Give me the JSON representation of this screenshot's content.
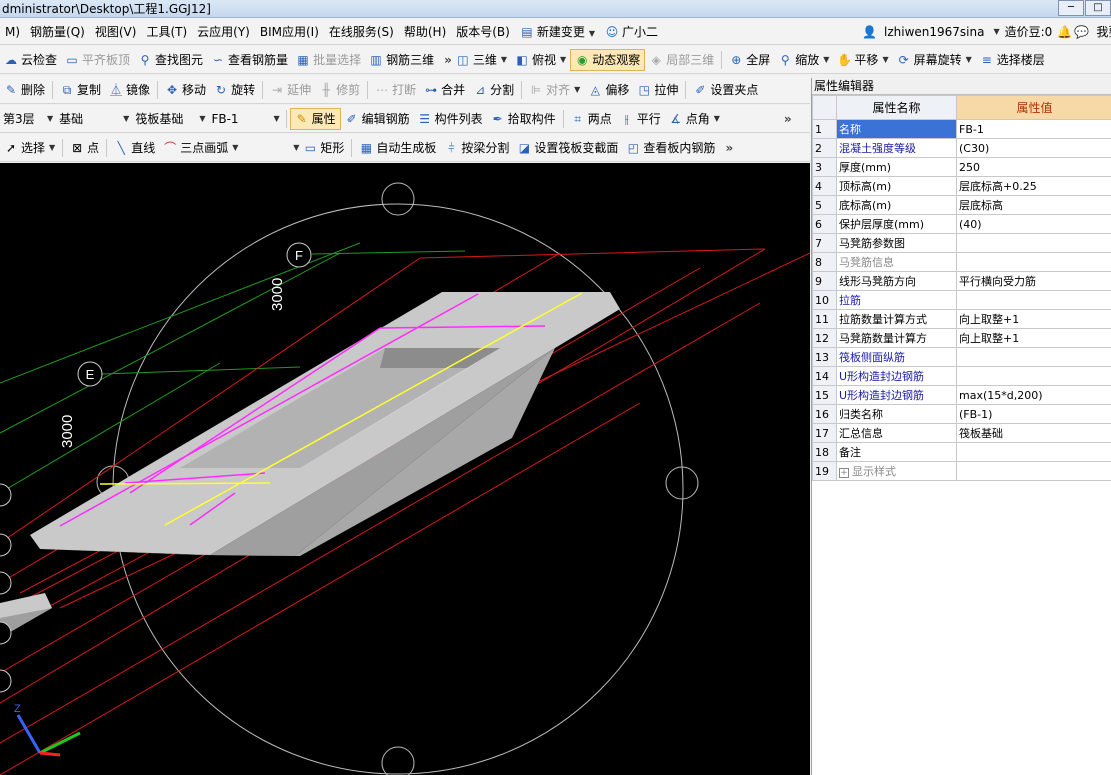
{
  "title": "dministrator\\Desktop\\工程1.GGJ12]",
  "menu": [
    "M)",
    "钢筋量(Q)",
    "视图(V)",
    "工具(T)",
    "云应用(Y)",
    "BIM应用(I)",
    "在线服务(S)",
    "帮助(H)",
    "版本号(B)",
    "新建变更",
    "广小二"
  ],
  "user": {
    "name": "lzhiwen1967sina",
    "price": "造价豆:0",
    "extra": "我要"
  },
  "toolbar1": [
    "云检查",
    "平齐板顶",
    "查找图元",
    "查看钢筋量",
    "批量选择",
    "钢筋三维",
    "三维",
    "俯视",
    "动态观察",
    "局部三维",
    "全屏",
    "缩放",
    "平移",
    "屏幕旋转",
    "选择楼层"
  ],
  "toolbar2": [
    "删除",
    "复制",
    "镜像",
    "移动",
    "旋转",
    "延伸",
    "修剪",
    "打断",
    "合并",
    "分割",
    "对齐",
    "偏移",
    "拉伸",
    "设置夹点"
  ],
  "toolbar3": {
    "floor": "第3层",
    "type": "基础",
    "subtype": "筏板基础",
    "element": "FB-1",
    "buttons": [
      "属性",
      "编辑钢筋",
      "构件列表",
      "拾取构件",
      "两点",
      "平行",
      "点角"
    ]
  },
  "toolbar4": [
    "选择",
    "点",
    "直线",
    "三点画弧",
    "矩形",
    "自动生成板",
    "按梁分割",
    "设置筏板变截面",
    "查看板内钢筋"
  ],
  "canvas": {
    "labels": {
      "axis_f": "F",
      "axis_e": "E",
      "dim_top": "3000",
      "dim_left": "3000"
    }
  },
  "panel": {
    "title": "属性编辑器",
    "col_name": "属性名称",
    "col_value": "属性值",
    "rows": [
      {
        "n": "1",
        "name": "名称",
        "value": "FB-1"
      },
      {
        "n": "2",
        "name": "混凝土强度等级",
        "value": "(C30)"
      },
      {
        "n": "3",
        "name": "厚度(mm)",
        "value": "250"
      },
      {
        "n": "4",
        "name": "顶标高(m)",
        "value": "层底标高+0.25"
      },
      {
        "n": "5",
        "name": "底标高(m)",
        "value": "层底标高"
      },
      {
        "n": "6",
        "name": "保护层厚度(mm)",
        "value": "(40)"
      },
      {
        "n": "7",
        "name": "马凳筋参数图",
        "value": ""
      },
      {
        "n": "8",
        "name": "马凳筋信息",
        "value": ""
      },
      {
        "n": "9",
        "name": "线形马凳筋方向",
        "value": "平行横向受力筋"
      },
      {
        "n": "10",
        "name": "拉筋",
        "value": ""
      },
      {
        "n": "11",
        "name": "拉筋数量计算方式",
        "value": "向上取整+1"
      },
      {
        "n": "12",
        "name": "马凳筋数量计算方",
        "value": "向上取整+1"
      },
      {
        "n": "13",
        "name": "筏板侧面纵筋",
        "value": ""
      },
      {
        "n": "14",
        "name": "U形构造封边钢筋",
        "value": ""
      },
      {
        "n": "15",
        "name": "U形构造封边钢筋",
        "value": "max(15*d,200)"
      },
      {
        "n": "16",
        "name": "归类名称",
        "value": "(FB-1)"
      },
      {
        "n": "17",
        "name": "汇总信息",
        "value": "筏板基础"
      },
      {
        "n": "18",
        "name": "备注",
        "value": ""
      },
      {
        "n": "19",
        "name": "显示样式",
        "value": ""
      }
    ]
  }
}
